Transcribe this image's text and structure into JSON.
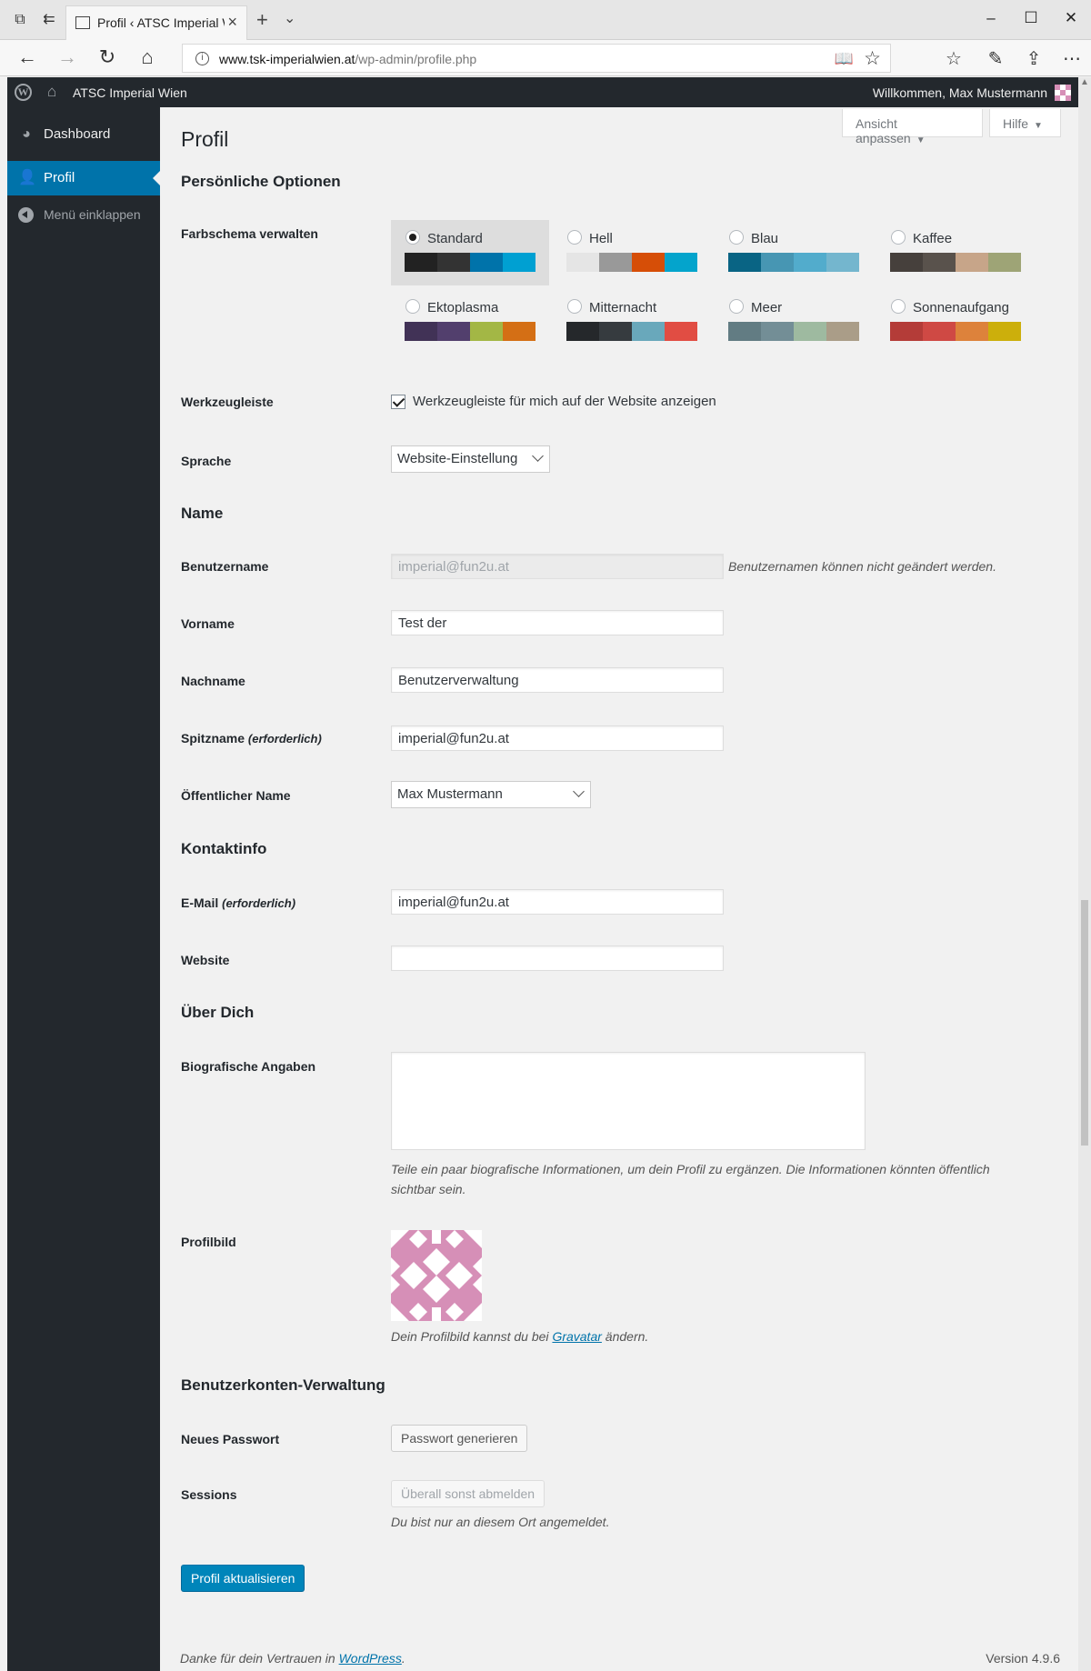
{
  "browser": {
    "tab_title": "Profil ‹ ATSC Imperial W",
    "url_host": "www.tsk-imperialwien.at",
    "url_path": "/wp-admin/profile.php"
  },
  "adminbar": {
    "site_name": "ATSC Imperial Wien",
    "welcome": "Willkommen, Max Mustermann"
  },
  "sidebar": {
    "items": [
      {
        "label": "Dashboard",
        "icon": "dashboard-icon"
      },
      {
        "label": "Profil",
        "icon": "user-icon"
      },
      {
        "label": "Menü einklappen",
        "icon": "collapse-icon"
      }
    ]
  },
  "screen_options": {
    "ansicht": "Ansicht anpassen",
    "hilfe": "Hilfe"
  },
  "page": {
    "title": "Profil",
    "section_personal": "Persönliche Optionen",
    "label_color_scheme": "Farbschema verwalten",
    "label_toolbar": "Werkzeugleiste",
    "toolbar_checkbox": "Werkzeugleiste für mich auf der Website anzeigen",
    "label_language": "Sprache",
    "language_value": "Website-Einstellung",
    "section_name": "Name",
    "label_username": "Benutzername",
    "username_value": "imperial@fun2u.at",
    "username_note": "Benutzernamen können nicht geändert werden.",
    "label_firstname": "Vorname",
    "firstname_value": "Test der",
    "label_lastname": "Nachname",
    "lastname_value": "Benutzerverwaltung",
    "label_nickname": "Spitzname",
    "required": "(erforderlich)",
    "nickname_value": "imperial@fun2u.at",
    "label_display_name": "Öffentlicher Name",
    "display_name_value": "Max Mustermann",
    "section_contact": "Kontaktinfo",
    "label_email": "E-Mail",
    "email_value": "imperial@fun2u.at",
    "label_website": "Website",
    "website_value": "",
    "section_about": "Über Dich",
    "label_bio": "Biografische Angaben",
    "bio_note": "Teile ein paar biografische Informationen, um dein Profil zu ergänzen. Die Informationen könnten öffentlich sichtbar sein.",
    "label_avatar": "Profilbild",
    "avatar_note_pre": "Dein Profilbild kannst du bei",
    "avatar_link": "Gravatar",
    "avatar_note_post": "ändern.",
    "section_account": "Benutzerkonten-Verwaltung",
    "label_new_password": "Neues Passwort",
    "generate_password": "Passwort generieren",
    "label_sessions": "Sessions",
    "logout_everywhere": "Überall sonst abmelden",
    "sessions_note": "Du bist nur an diesem Ort angemeldet.",
    "submit": "Profil aktualisieren"
  },
  "color_schemes": [
    {
      "name": "Standard",
      "selected": true,
      "colors": [
        "#222222",
        "#333333",
        "#0073aa",
        "#00a0d2"
      ]
    },
    {
      "name": "Hell",
      "selected": false,
      "colors": [
        "#e5e5e5",
        "#999999",
        "#d64e07",
        "#04a4cc"
      ]
    },
    {
      "name": "Blau",
      "selected": false,
      "colors": [
        "#096484",
        "#4796b3",
        "#52accc",
        "#74b6ce"
      ]
    },
    {
      "name": "Kaffee",
      "selected": false,
      "colors": [
        "#46403c",
        "#59524c",
        "#c7a589",
        "#9ea476"
      ]
    },
    {
      "name": "Ektoplasma",
      "selected": false,
      "colors": [
        "#413256",
        "#523f6d",
        "#a3b745",
        "#d46f15"
      ]
    },
    {
      "name": "Mitternacht",
      "selected": false,
      "colors": [
        "#25282b",
        "#363b3f",
        "#69a8bb",
        "#e14d43"
      ]
    },
    {
      "name": "Meer",
      "selected": false,
      "colors": [
        "#627c83",
        "#738e96",
        "#9ebaa0",
        "#aa9d88"
      ]
    },
    {
      "name": "Sonnenaufgang",
      "selected": false,
      "colors": [
        "#b43c38",
        "#cf4944",
        "#dd823b",
        "#ccaf0b"
      ]
    }
  ],
  "footer": {
    "thanks_pre": "Danke für dein Vertrauen in",
    "thanks_link": "WordPress",
    "version": "Version 4.9.6"
  },
  "colors": {
    "admin_dark": "#23282d",
    "accent": "#0073aa",
    "avatar_pink": "#d68fb7"
  }
}
